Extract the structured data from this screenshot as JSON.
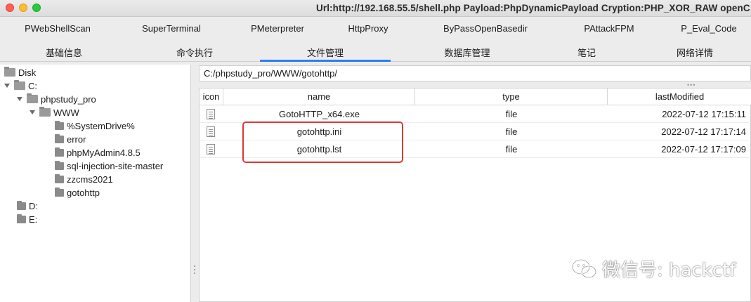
{
  "window": {
    "title": "Url:http://192.168.55.5/shell.php Payload:PhpDynamicPayload Cryption:PHP_XOR_RAW openC"
  },
  "plugin_tabs": [
    {
      "label": "PWebShellScan"
    },
    {
      "label": "SuperTerminal"
    },
    {
      "label": "PMeterpreter"
    },
    {
      "label": "HttpProxy"
    },
    {
      "label": "ByPassOpenBasedir"
    },
    {
      "label": "PAttackFPM"
    },
    {
      "label": "P_Eval_Code"
    }
  ],
  "main_tabs": [
    {
      "label": "基础信息"
    },
    {
      "label": "命令执行"
    },
    {
      "label": "文件管理"
    },
    {
      "label": "数据库管理"
    },
    {
      "label": "笔记"
    },
    {
      "label": "网络详情"
    }
  ],
  "selected_main_tab": "文件管理",
  "tree": {
    "root": "Disk",
    "drive_c": "C:",
    "phpstudy": "phpstudy_pro",
    "www": "WWW",
    "www_children": [
      {
        "label": "%SystemDrive%"
      },
      {
        "label": "error"
      },
      {
        "label": "phpMyAdmin4.8.5"
      },
      {
        "label": "sql-injection-site-master"
      },
      {
        "label": "zzcms2021"
      },
      {
        "label": "gotohttp"
      }
    ],
    "drive_d": "D:",
    "drive_e": "E:"
  },
  "path": "C:/phpstudy_pro/WWW/gotohttp/",
  "table": {
    "columns": {
      "icon": "icon",
      "name": "name",
      "type": "type",
      "lastModified": "lastModified"
    },
    "rows": [
      {
        "name": "GotoHTTP_x64.exe",
        "type": "file",
        "lastModified": "2022-07-12 17:15:11"
      },
      {
        "name": "gotohttp.ini",
        "type": "file",
        "lastModified": "2022-07-12 17:17:14"
      },
      {
        "name": "gotohttp.lst",
        "type": "file",
        "lastModified": "2022-07-12 17:17:09"
      }
    ]
  },
  "watermark": {
    "text": "微信号: hackctf"
  },
  "colors": {
    "accent": "#2f7cf6",
    "highlight": "#d93a33"
  }
}
